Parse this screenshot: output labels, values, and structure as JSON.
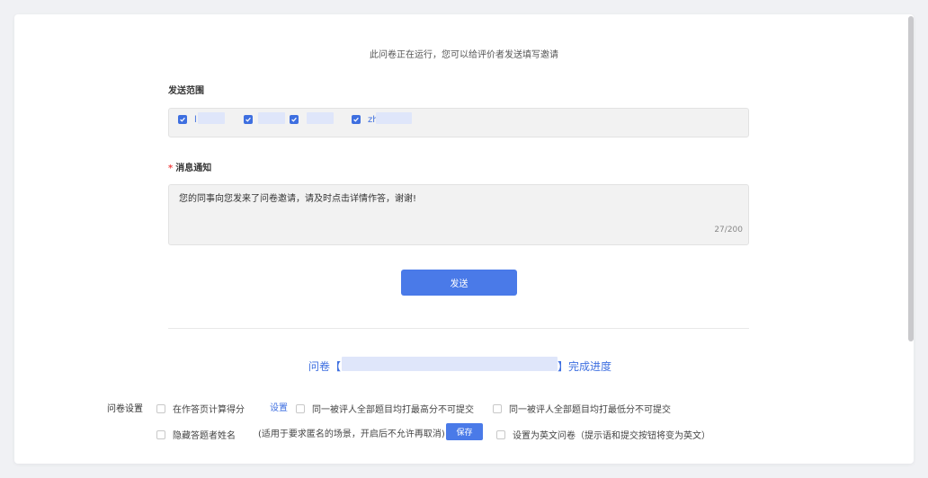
{
  "notice": "此问卷正在运行，您可以给评价者发送填写邀请",
  "send_scope": {
    "label": "发送范围",
    "recipients": [
      {
        "name": "l",
        "checked": true
      },
      {
        "name": "",
        "checked": true
      },
      {
        "name": "",
        "checked": true
      },
      {
        "name": "zh",
        "checked": true
      }
    ]
  },
  "message": {
    "required_mark": "*",
    "label": "消息通知",
    "text": "您的同事向您发来了问卷邀请，请及时点击详情作答，谢谢!",
    "count": "27/200"
  },
  "send_button": "发送",
  "progress": {
    "prefix": "问卷【",
    "suffix": "】完成进度"
  },
  "settings": {
    "label": "问卷设置",
    "options": [
      {
        "text": "在作答页计算得分",
        "checked": false
      },
      {
        "text": "同一被评人全部题目均打最高分不可提交",
        "checked": false
      },
      {
        "text": "同一被评人全部题目均打最低分不可提交",
        "checked": false
      },
      {
        "text": "隐藏答题者姓名",
        "checked": false
      },
      {
        "text": "设置为英文问卷（提示语和提交按钮将变为英文）",
        "checked": false
      }
    ],
    "config_link": "设置",
    "anonymous_hint": "(适用于要求匿名的场景，开启后不允许再取消)",
    "save_button": "保存"
  },
  "colors": {
    "accent": "#3e6fe0",
    "button": "#4a7ae8",
    "required": "#f04848"
  }
}
